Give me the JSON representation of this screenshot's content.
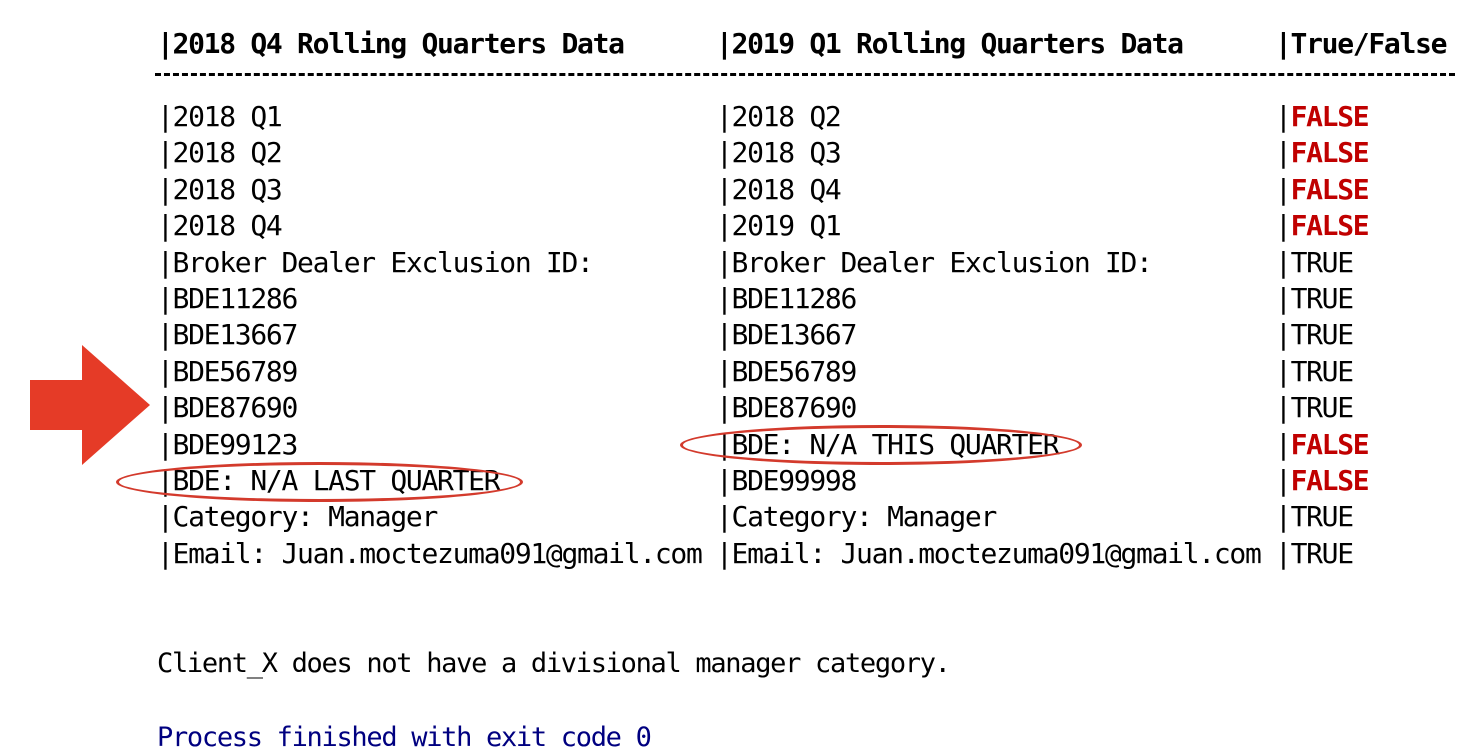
{
  "table": {
    "headers": [
      "|2018 Q4 Rolling Quarters Data",
      "|2019 Q1 Rolling Quarters Data",
      "|True/False"
    ],
    "rows": [
      {
        "c1": "|2018 Q1",
        "c2": "|2018 Q2",
        "c3": "|",
        "r": "FALSE"
      },
      {
        "c1": "|2018 Q2",
        "c2": "|2018 Q3",
        "c3": "|",
        "r": "FALSE"
      },
      {
        "c1": "|2018 Q3",
        "c2": "|2018 Q4",
        "c3": "|",
        "r": "FALSE"
      },
      {
        "c1": "|2018 Q4",
        "c2": "|2019 Q1",
        "c3": "|",
        "r": "FALSE"
      },
      {
        "c1": "|Broker Dealer Exclusion ID:",
        "c2": "|Broker Dealer Exclusion ID:",
        "c3": "|",
        "r": "TRUE"
      },
      {
        "c1": "|BDE11286",
        "c2": "|BDE11286",
        "c3": "|",
        "r": "TRUE"
      },
      {
        "c1": "|BDE13667",
        "c2": "|BDE13667",
        "c3": "|",
        "r": "TRUE"
      },
      {
        "c1": "|BDE56789",
        "c2": "|BDE56789",
        "c3": "|",
        "r": "TRUE"
      },
      {
        "c1": "|BDE87690",
        "c2": "|BDE87690",
        "c3": "|",
        "r": "TRUE"
      },
      {
        "c1": "|BDE99123",
        "c2": "|BDE: N/A THIS QUARTER",
        "c3": "|",
        "r": "FALSE"
      },
      {
        "c1": "|BDE: N/A LAST QUARTER",
        "c2": "|BDE99998",
        "c3": "|",
        "r": "FALSE"
      },
      {
        "c1": "|Category: Manager",
        "c2": "|Category: Manager",
        "c3": "|",
        "r": "TRUE"
      },
      {
        "c1": "|Email: Juan.moctezuma091@gmail.com",
        "c2": "|Email: Juan.moctezuma091@gmail.com",
        "c3": "|",
        "r": "TRUE"
      }
    ]
  },
  "messages": {
    "info": "Client_X does not have a divisional manager category.",
    "exit": "Process finished with exit code 0"
  },
  "colors": {
    "false_text": "#c00000",
    "annotation": "#d33a2c",
    "exit_message": "#000080"
  },
  "annotations": {
    "arrow_icon": "right-arrow-icon",
    "ellipse_icon": "highlight-ellipse-icon"
  }
}
